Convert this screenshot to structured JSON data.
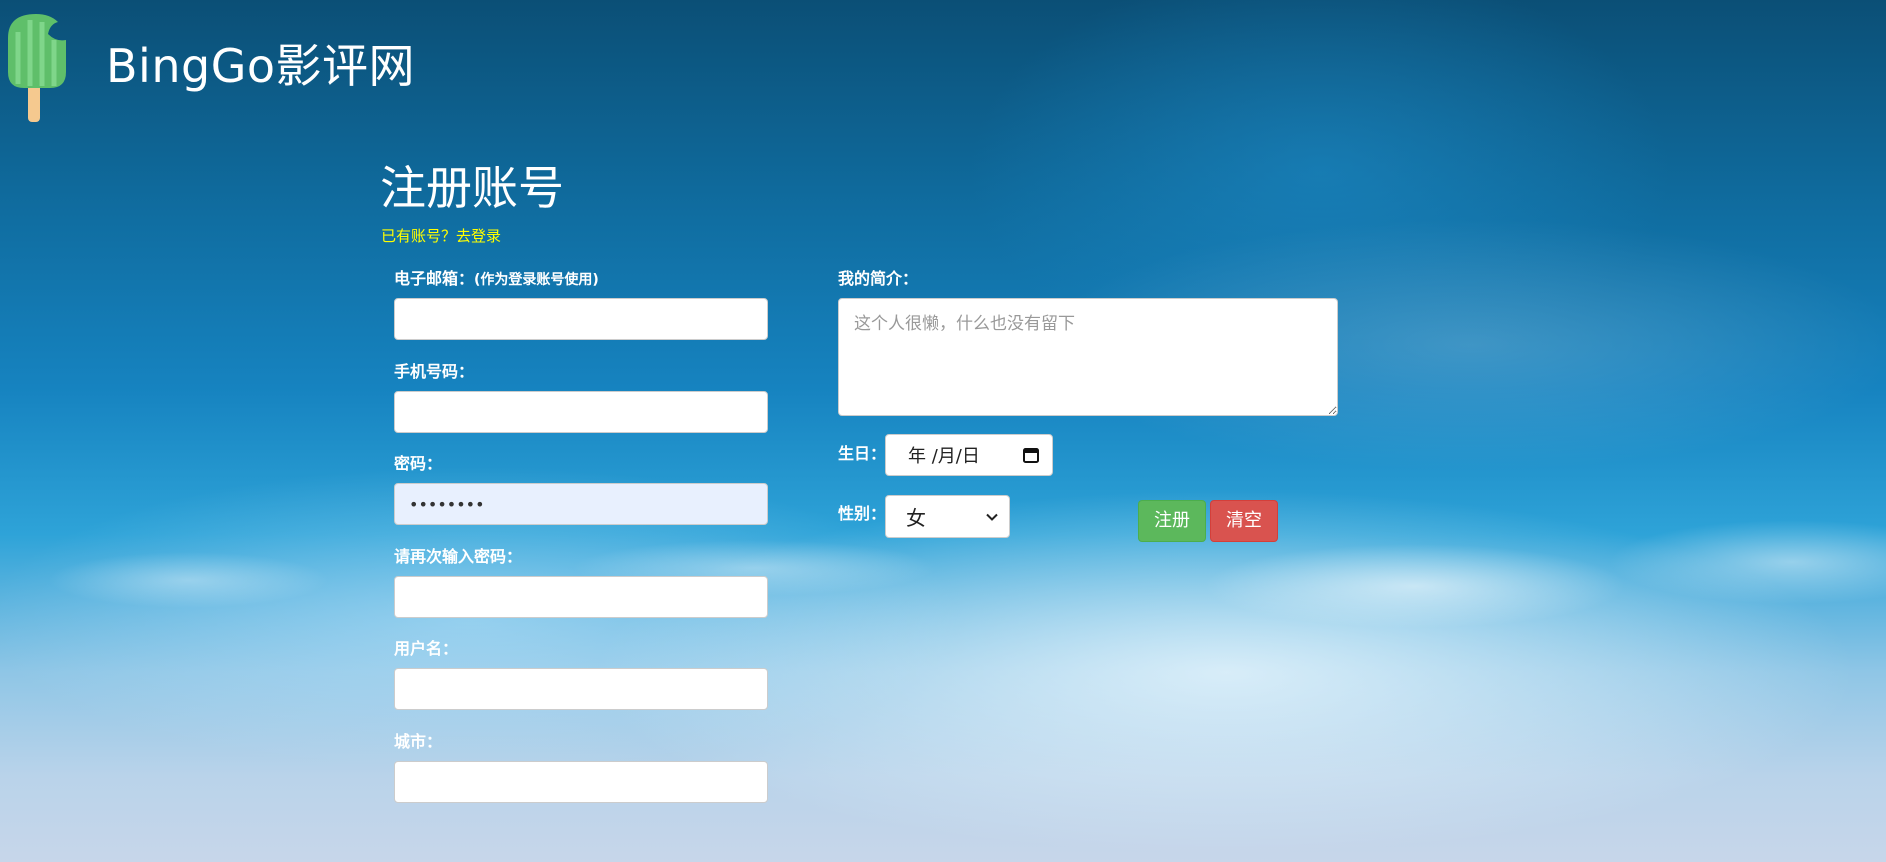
{
  "header": {
    "brand": "BingGo影评网",
    "logo_icon": "popsicle-icon"
  },
  "page": {
    "title": "注册账号",
    "login_link": "已有账号？去登录"
  },
  "form": {
    "email": {
      "label": "电子邮箱：",
      "hint": "(作为登录账号使用)",
      "value": ""
    },
    "phone": {
      "label": "手机号码：",
      "value": ""
    },
    "password": {
      "label": "密码：",
      "value": "••••••••"
    },
    "confirm_password": {
      "label": "请再次输入密码：",
      "value": ""
    },
    "username": {
      "label": "用户名：",
      "value": ""
    },
    "city": {
      "label": "城市：",
      "value": ""
    },
    "bio": {
      "label": "我的简介：",
      "placeholder": "这个人很懒，什么也没有留下",
      "value": ""
    },
    "birthday": {
      "label": "生日：",
      "value": "年 /月/日",
      "icon": "calendar-icon"
    },
    "gender": {
      "label": "性别：",
      "selected": "女",
      "icon": "chevron-down-icon"
    },
    "register_button": "注册",
    "clear_button": "清空"
  },
  "colors": {
    "login_link": "#ffff00",
    "register_button": "#5cb85c",
    "clear_button": "#d9534f",
    "autofill_bg": "#e8f0fe"
  }
}
